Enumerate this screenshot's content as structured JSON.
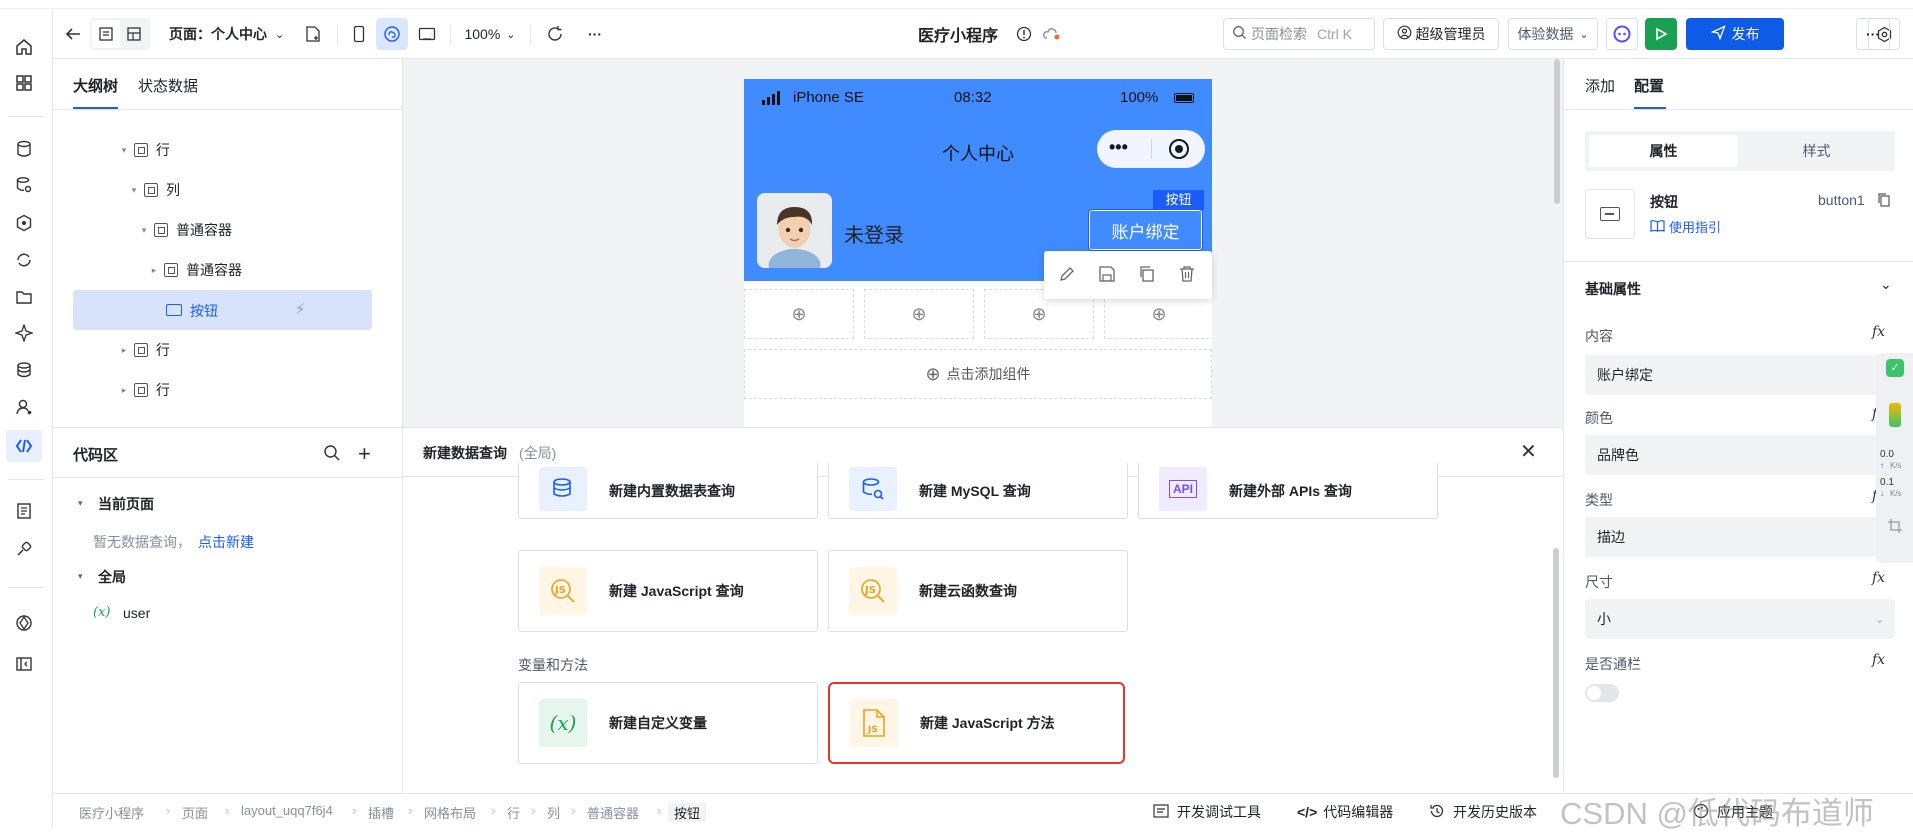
{
  "toolbar": {
    "page_selector": "页面：个人中心",
    "zoom": "100%",
    "app_title": "医疗小程序",
    "search_placeholder": "页面检索",
    "search_shortcut": "Ctrl K",
    "user_role": "超级管理员",
    "data_env": "体验数据",
    "publish_label": "发布",
    "more_label": "···"
  },
  "outline": {
    "tabs": [
      "大纲树",
      "状态数据"
    ],
    "nodes": [
      {
        "label": "行",
        "caret": "▾"
      },
      {
        "label": "列",
        "caret": "▾"
      },
      {
        "label": "普通容器",
        "caret": "▾"
      },
      {
        "label": "普通容器",
        "caret": "▸"
      },
      {
        "label": "按钮",
        "caret": ""
      },
      {
        "label": "行",
        "caret": "▸"
      },
      {
        "label": "行",
        "caret": "▸"
      }
    ]
  },
  "phone": {
    "carrier": "iPhone SE",
    "time": "08:32",
    "battery": "100%",
    "page_title": "个人中心",
    "capsule_more": "•••",
    "user_status": "未登录",
    "selected_tag": "按钮",
    "bind_button": "账户绑定",
    "add_component": "点击添加组件"
  },
  "code_area": {
    "title": "代码区",
    "current_page": "当前页面",
    "empty_text": "暂无数据查询，",
    "create_link": "点击新建",
    "global": "全局",
    "var_symbol": "(𝑥)",
    "var_name": "user"
  },
  "query_panel": {
    "title": "新建数据查询",
    "scope": "(全局)",
    "cards": [
      "新建内置数据表查询",
      "新建 MySQL 查询",
      "新建外部 APIs 查询",
      "新建 JavaScript 查询",
      "新建云函数查询"
    ],
    "section_label": "变量和方法",
    "var_cards": [
      "新建自定义变量",
      "新建 JavaScript 方法"
    ],
    "api_icon_text": "API"
  },
  "right_panel": {
    "tabs": [
      "添加",
      "配置"
    ],
    "segments": [
      "属性",
      "样式"
    ],
    "component_name": "按钮",
    "component_id": "button1",
    "guide_link": "使用指引",
    "section": "基础属性",
    "props": [
      {
        "label": "内容",
        "value": "账户绑定"
      },
      {
        "label": "颜色",
        "value": "品牌色"
      },
      {
        "label": "类型",
        "value": "描边"
      },
      {
        "label": "尺寸",
        "value": "小"
      },
      {
        "label": "是否通栏",
        "value": ""
      }
    ],
    "fx": "fx",
    "speed_up": "0.0",
    "speed_down": "0.1",
    "speed_unit": "K/s"
  },
  "statusbar": {
    "breadcrumbs": [
      "医疗小程序",
      "页面",
      "layout_uqq7f6j4",
      "插槽",
      "网格布局",
      "行",
      "列",
      "普通容器",
      "按钮"
    ],
    "tools": [
      "开发调试工具",
      "代码编辑器",
      "开发历史版本"
    ],
    "apply_theme": "应用主题",
    "watermark": "CSDN @低代码布道师"
  },
  "colors": {
    "brand": "#1a5cf5",
    "phone_header": "#3f8bff",
    "publish": "#0e5be8",
    "run": "#1aa053",
    "highlight_border": "#e0392b"
  }
}
